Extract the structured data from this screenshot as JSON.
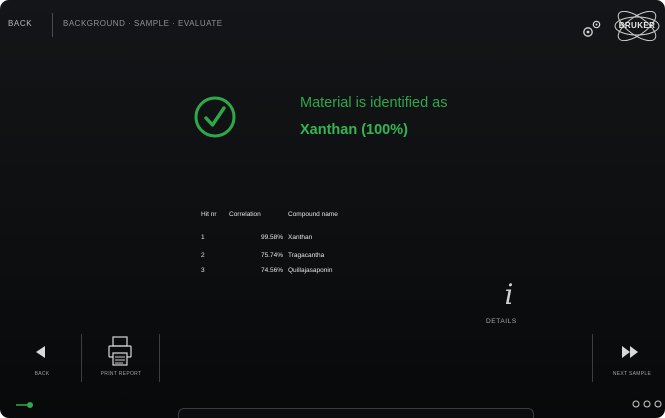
{
  "header": {
    "back_label": "BACK",
    "breadcrumb": "BACKGROUND · SAMPLE · EVALUATE",
    "logo_text": "BRUKER"
  },
  "result": {
    "message": "Material is identified as",
    "material": "Xanthan (100%)"
  },
  "hit_table": {
    "columns": [
      "Hit nr",
      "Correlation",
      "Compound name"
    ],
    "rows": [
      {
        "hit": "1",
        "correlation": "99.58%",
        "compound": "Xanthan"
      },
      {
        "hit": "2",
        "correlation": "75.74%",
        "compound": "Tragacantha"
      },
      {
        "hit": "3",
        "correlation": "74.56%",
        "compound": "Quillajasaponin"
      }
    ]
  },
  "details": {
    "icon_glyph": "i",
    "label": "DETAILS"
  },
  "footer": {
    "back_label": "BACK",
    "print_label": "PRINT REPORT",
    "next_label": "NEXT SAMPLE"
  },
  "colors": {
    "accent_green": "#2fa84a",
    "background": "#111214",
    "text_light": "#e4e4e4"
  },
  "icons": [
    "gear-icon",
    "bruker-logo",
    "check-circle-icon",
    "info-icon",
    "back-arrow-icon",
    "printer-icon",
    "fast-forward-icon",
    "plug-icon",
    "page-dots-icon"
  ]
}
